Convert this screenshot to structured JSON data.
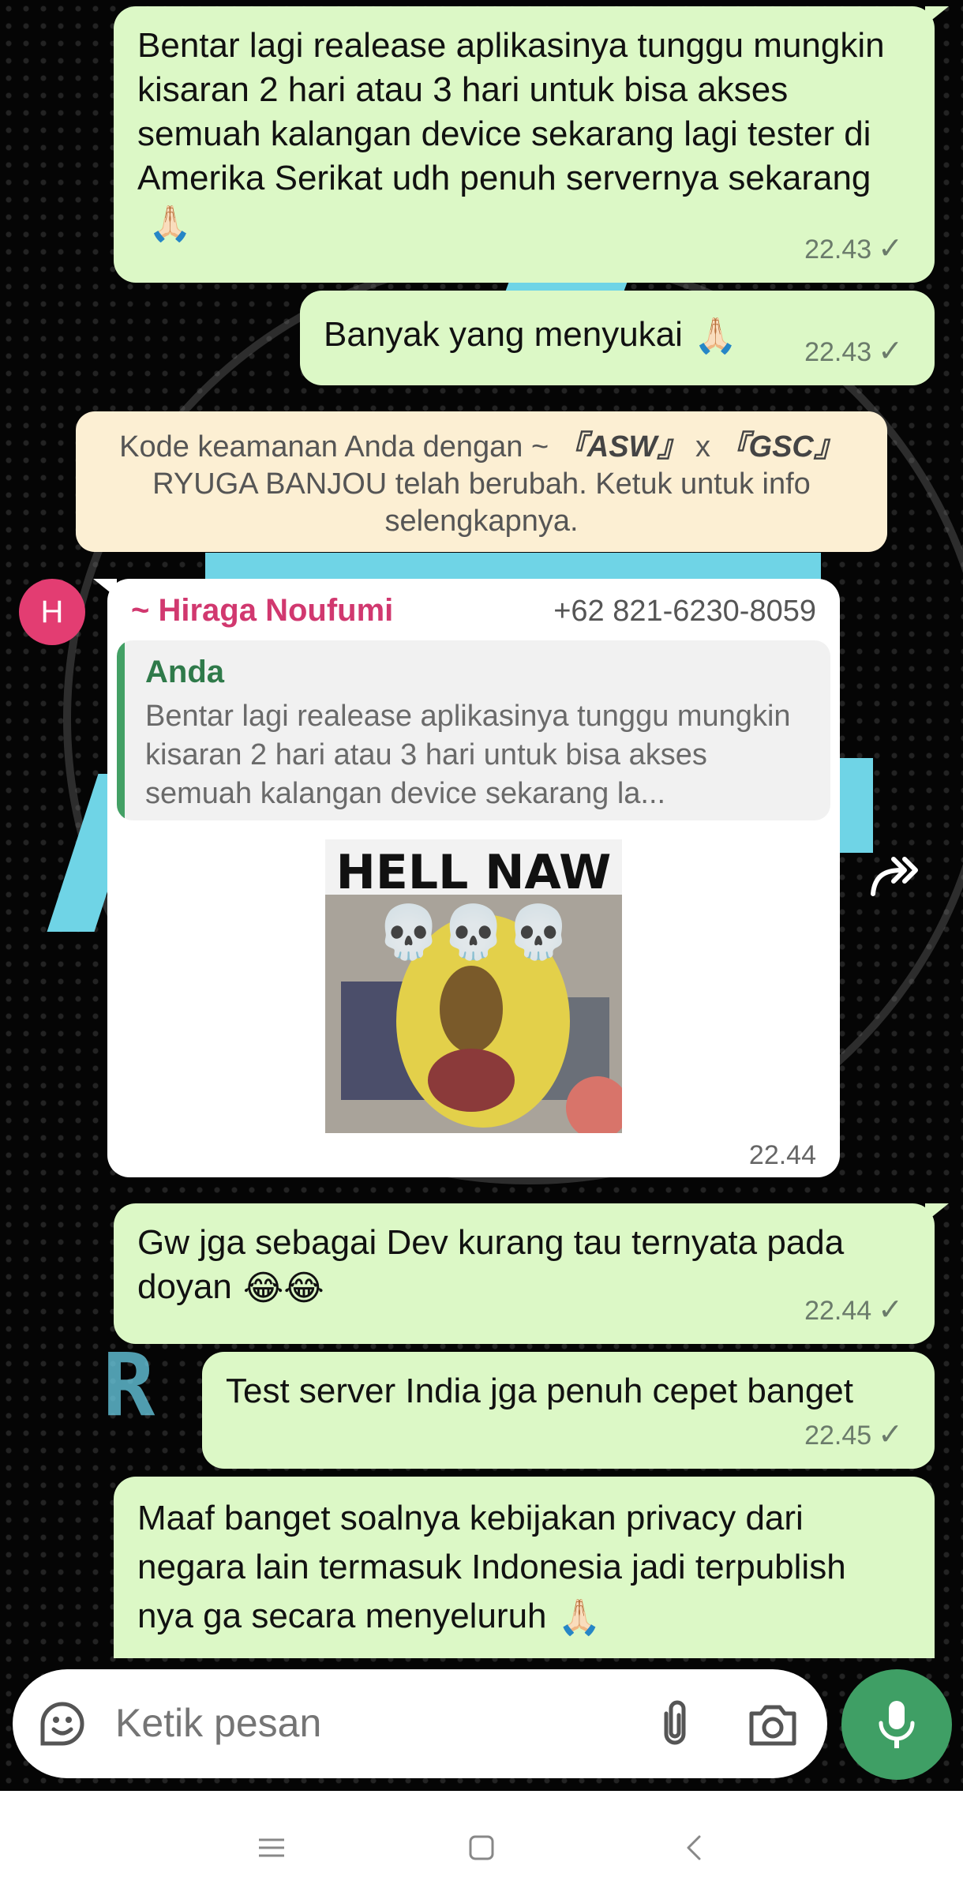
{
  "messages": [
    {
      "text": "Bentar lagi realease aplikasinya tunggu mungkin kisaran 2 hari atau 3 hari untuk bisa akses semuah kalangan device sekarang lagi tester di Amerika Serikat udh penuh servernya sekarang",
      "time": "22.43",
      "emoji": "🙏🏻"
    },
    {
      "text": "Banyak yang menyukai",
      "time": "22.43",
      "emoji": "🙏🏻"
    },
    {
      "text": "Gw jga sebagai Dev kurang tau ternyata pada doyan",
      "time": "22.44",
      "emoji": "😂😂"
    },
    {
      "text": "Test server India jga penuh cepet banget",
      "time": "22.45"
    },
    {
      "text": "Maaf banget soalnya kebijakan privacy dari negara lain termasuk Indonesia jadi terpublish nya ga secara menyeluruh",
      "emoji": "🙏🏻"
    }
  ],
  "system_note": {
    "prefix": "Kode keamanan Anda dengan ~ ",
    "tag1": "『ASW』",
    "mid": " x ",
    "tag2": "『GSC』",
    "suffix": " RYUGA BANJOU telah berubah. Ketuk untuk info selengkapnya."
  },
  "incoming": {
    "avatar_letter": "H",
    "sender": "~ Hiraga Noufumi",
    "phone": "+62 821-6230-8059",
    "quote_name": "Anda",
    "quote_text": "Bentar lagi realease aplikasinya tunggu mungkin kisaran 2 hari atau 3 hari untuk bisa akses semuah kalangan device sekarang la...",
    "sticker_caption": "HELL NAW",
    "sticker_emoji": "💀💀💀",
    "time": "22.44"
  },
  "composer": {
    "placeholder": "Ketik pesan"
  },
  "status": {
    "check": "✓"
  },
  "icons": [
    "sticker-icon",
    "attach-icon",
    "camera-icon",
    "mic-icon",
    "forward-icon",
    "nav-menu-icon",
    "nav-home-icon",
    "nav-back-icon"
  ],
  "colors": {
    "outgoing_bubble": "#dcf8c6",
    "sender_name": "#d1386f",
    "quote_bar": "#43a065",
    "mic_button": "#3f9f65",
    "system_note": "#fcefd3"
  }
}
